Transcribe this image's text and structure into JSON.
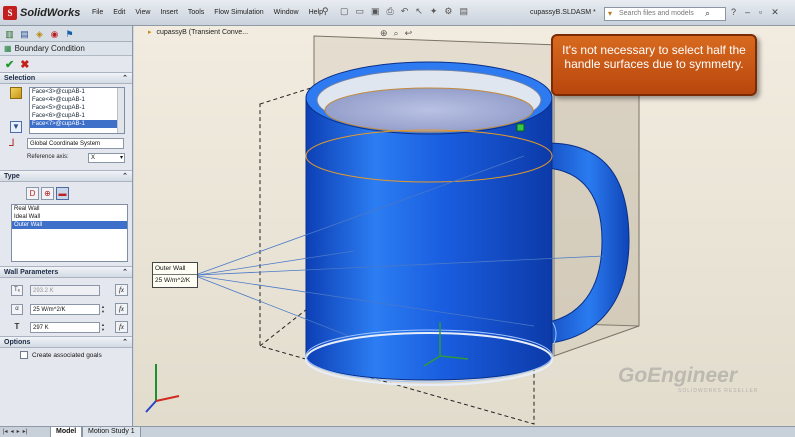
{
  "app": {
    "name": "SolidWorks",
    "logo_mark": "S",
    "document": "cupassyB.SLDASM *"
  },
  "menus": [
    "File",
    "Edit",
    "View",
    "Insert",
    "Tools",
    "Flow Simulation",
    "Window",
    "Help"
  ],
  "search": {
    "placeholder": "Search files and models"
  },
  "panel": {
    "title": "Boundary Condition",
    "selection": {
      "header": "Selection",
      "faces": [
        "Face<3>@cupAB-1",
        "Face<4>@cupAB-1",
        "Face<5>@cupAB-1",
        "Face<6>@cupAB-1",
        "Face<7>@cupAB-1"
      ],
      "selected_index": 4,
      "coordinate_system": "Global Coordinate System",
      "reference_axis_label": "Reference axis:",
      "reference_axis_value": "X"
    },
    "type": {
      "header": "Type",
      "options": [
        "Real Wall",
        "Ideal Wall",
        "Outer Wall"
      ],
      "selected_index": 2
    },
    "wall_parameters": {
      "header": "Wall Parameters",
      "ambient_temp": "293.2 K",
      "heat_transfer_coeff": "25 W/m^2/K",
      "temperature": "297 K"
    },
    "options": {
      "header": "Options",
      "create_goals_label": "Create associated goals"
    }
  },
  "viewport": {
    "tree_label": "cupassyB (Transient Conve...",
    "callout": "It's not necessary to select half the handle surfaces due to symmetry.",
    "outer_wall_tag": {
      "title": "Outer Wall",
      "value": "25 W/m^2/K"
    },
    "watermark": "GoEngineer",
    "watermark_sub": "SOLIDWORKS RESELLER",
    "colors": {
      "mug": "#1f5fd6",
      "callout": "#c85a14"
    }
  },
  "bottom_tabs": [
    "Model",
    "Motion Study 1"
  ]
}
